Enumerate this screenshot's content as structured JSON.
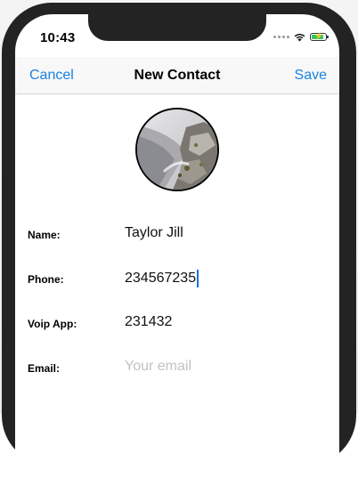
{
  "status_bar": {
    "time": "10:43",
    "icons": [
      "signal-dots-icon",
      "wifi-icon",
      "battery-charging-icon"
    ],
    "battery_color": "#33c759"
  },
  "navbar": {
    "cancel_label": "Cancel",
    "title": "New Contact",
    "save_label": "Save",
    "accent_color": "#1a82e0"
  },
  "form": {
    "name": {
      "label": "Name:",
      "value": "Taylor Jill"
    },
    "phone": {
      "label": "Phone:",
      "value": "234567235"
    },
    "voip": {
      "label": "Voip App:",
      "value": "231432"
    },
    "email": {
      "label": "Email:",
      "placeholder": "Your email"
    }
  }
}
